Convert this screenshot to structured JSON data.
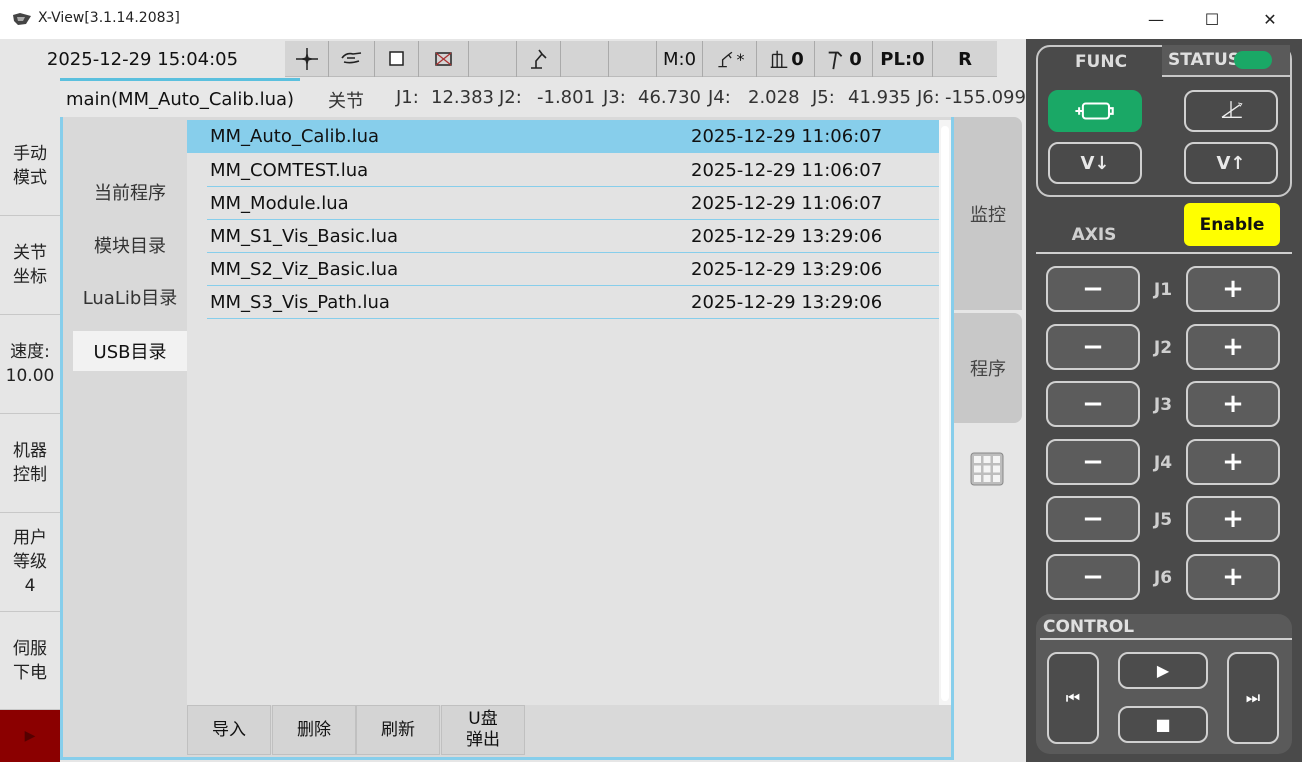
{
  "window": {
    "title": "X-View[3.1.14.2083]",
    "minimize": "—",
    "maximize": "☐",
    "close": "✕"
  },
  "header": {
    "datetime": "2025-12-29 15:04:05"
  },
  "toolbar": {
    "mode": "M:0",
    "tool_flag": "*",
    "coord_index": "0",
    "tool_index": "0",
    "payload": "PL:0",
    "r_label": "R"
  },
  "joints": {
    "mode_label": "关节",
    "items": [
      {
        "label": "J1:",
        "value": "12.383"
      },
      {
        "label": "J2:",
        "value": "-1.801"
      },
      {
        "label": "J3:",
        "value": "46.730"
      },
      {
        "label": "J4:",
        "value": "2.028"
      },
      {
        "label": "J5:",
        "value": "41.935"
      },
      {
        "label": "J6:",
        "value": "-155.099"
      }
    ]
  },
  "tab": {
    "title": "main(MM_Auto_Calib.lua)"
  },
  "leftnav": {
    "items": [
      "手动\n模式",
      "关节\n坐标",
      "速度:\n10.00",
      "机器\n控制",
      "用户\n等级\n4",
      "伺服\n下电"
    ],
    "red_icon": "play-triangle-icon"
  },
  "categories": {
    "items": [
      "当前程序",
      "模块目录",
      "LuaLib目录",
      "USB目录"
    ],
    "selected": "USB目录"
  },
  "files": [
    {
      "name": "MM_Auto_Calib.lua",
      "date": "2025-12-29 11:06:07"
    },
    {
      "name": "MM_COMTEST.lua",
      "date": "2025-12-29 11:06:07"
    },
    {
      "name": "MM_Module.lua",
      "date": "2025-12-29 11:06:07"
    },
    {
      "name": "MM_S1_Vis_Basic.lua",
      "date": "2025-12-29 13:29:06"
    },
    {
      "name": "MM_S2_Viz_Basic.lua",
      "date": "2025-12-29 13:29:06"
    },
    {
      "name": "MM_S3_Vis_Path.lua",
      "date": "2025-12-29 13:29:06"
    }
  ],
  "actions": {
    "import": "导入",
    "delete": "删除",
    "refresh": "刷新",
    "eject": "U盘\n弹出"
  },
  "righttabs": {
    "monitor": "监控",
    "program": "程序"
  },
  "func": {
    "label": "FUNC",
    "status_label": "STATUS",
    "v_down": "V↓",
    "v_up": "V↑",
    "status_color": "#1aa866",
    "motor_color": "#1aa866"
  },
  "axis": {
    "label": "AXIS",
    "enable": "Enable",
    "minus": "−",
    "plus": "+",
    "joints": [
      "J1",
      "J2",
      "J3",
      "J4",
      "J5",
      "J6"
    ]
  },
  "control": {
    "label": "CONTROL"
  }
}
